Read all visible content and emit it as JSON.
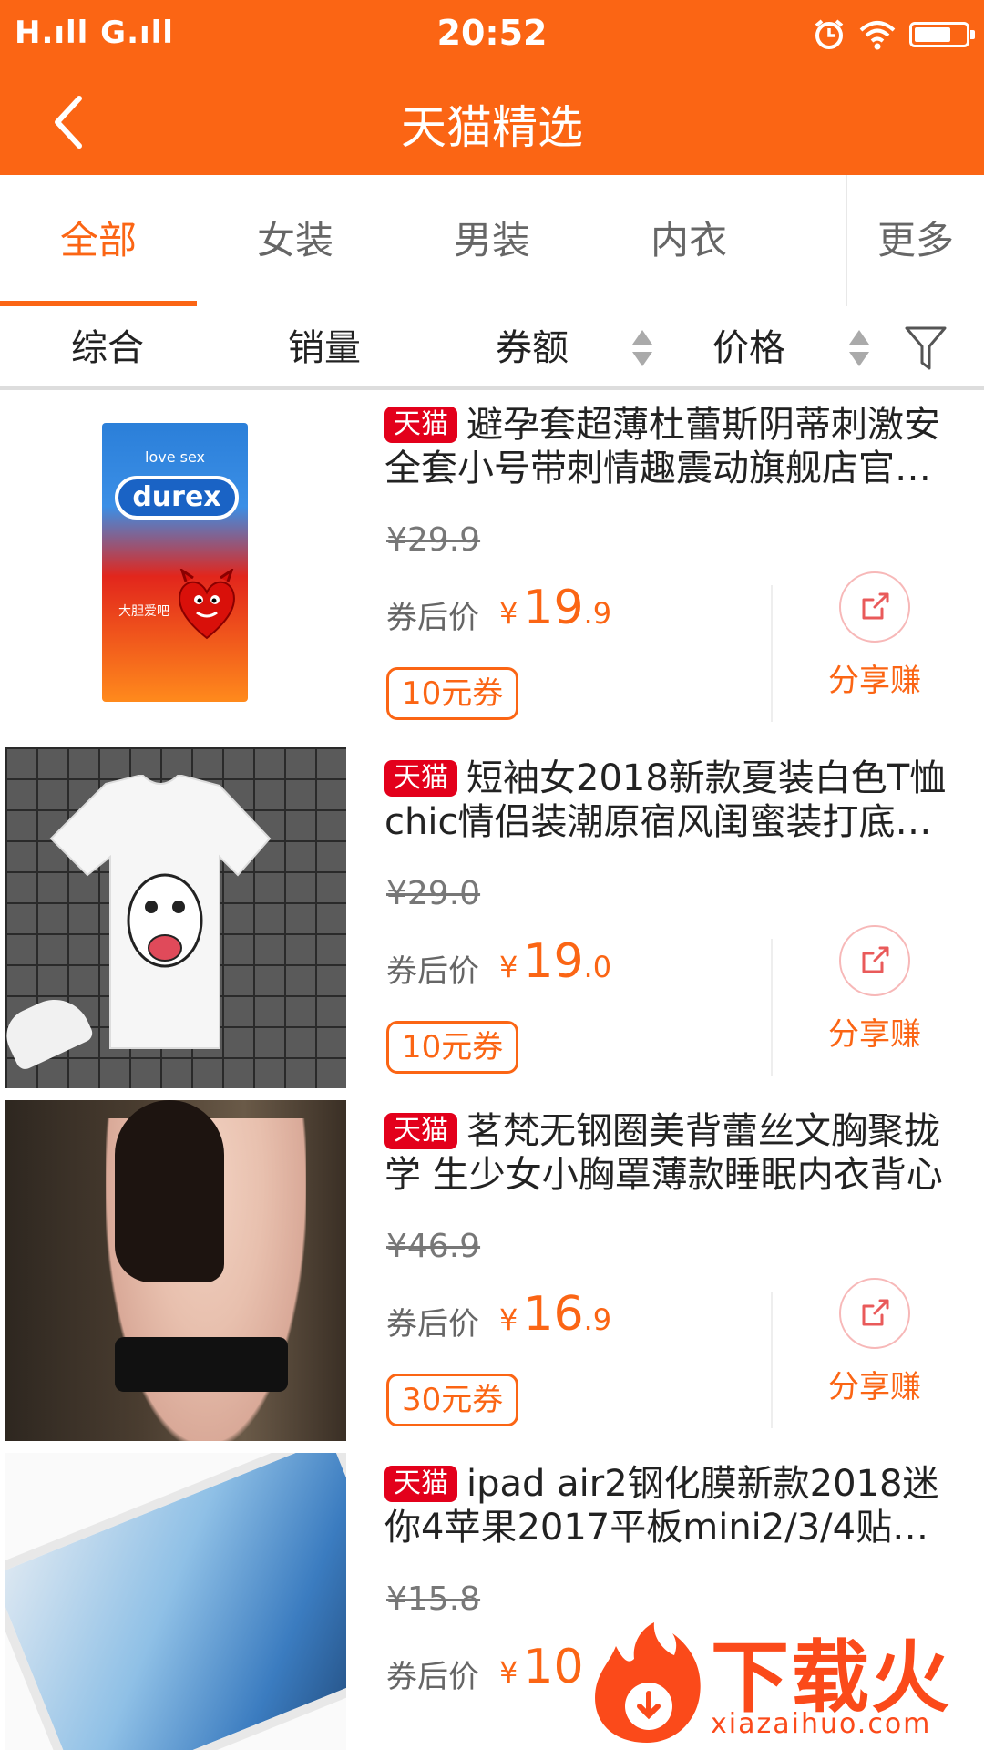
{
  "status": {
    "signal": "H.ıll G.ıll",
    "time": "20:52",
    "battery_level": 0.72
  },
  "header": {
    "title": "天猫精选"
  },
  "tabs": [
    {
      "label": "全部"
    },
    {
      "label": "女装"
    },
    {
      "label": "男装"
    },
    {
      "label": "内衣"
    },
    {
      "label": "更多"
    }
  ],
  "sort": {
    "comprehensive": "综合",
    "sales": "销量",
    "coupon": "券额",
    "price": "价格"
  },
  "badge": "天猫",
  "after_label": "券后价",
  "share_label": "分享赚",
  "currency": "¥",
  "products": [
    {
      "title": "避孕套超薄杜蕾斯阴蒂刺激安全套小号带刺情趣震动旗舰店官…",
      "original_price": "¥29.9",
      "price_int": "19",
      "price_dec": ".9",
      "coupon": "10元券",
      "thumb_text": "love sex",
      "thumb_brand": "durex",
      "thumb_line1": "大胆爱吧"
    },
    {
      "title": "短袖女2018新款夏装白色T恤chic情侣装潮原宿风闺蜜装打底…",
      "original_price": "¥29.0",
      "price_int": "19",
      "price_dec": ".0",
      "coupon": "10元券"
    },
    {
      "title": "茗梵无钢圈美背蕾丝文胸聚拢学 生少女小胸罩薄款睡眠内衣背心",
      "original_price": "¥46.9",
      "price_int": "16",
      "price_dec": ".9",
      "coupon": "30元券"
    },
    {
      "title": "ipad air2钢化膜新款2018迷你4苹果2017平板mini2/3/4贴…",
      "original_price": "¥15.8",
      "price_int": "10",
      "price_dec": "",
      "coupon": ""
    }
  ],
  "watermark": {
    "text": "下载火",
    "url": "xiazaihuo.com"
  }
}
